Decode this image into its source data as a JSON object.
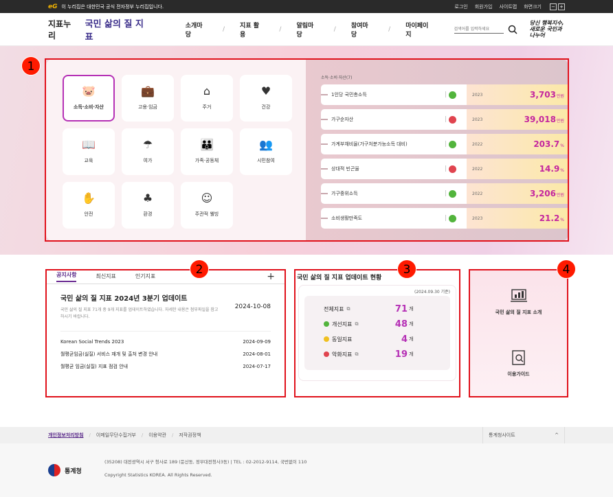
{
  "govbar": {
    "logo": "eG",
    "notice": "이 누리집은 대한민국 공식 전자정부 누리집입니다.",
    "links": [
      "로그인",
      "회원가입",
      "사이트맵",
      "화면크기"
    ]
  },
  "header": {
    "brand_small": "지표누리",
    "brand_main": "국민 삶의 질 지표",
    "nav": [
      "소개마당",
      "지표 활용",
      "알림마당",
      "참여마당",
      "마이페이지"
    ],
    "search_placeholder": "검색어를 입력하세요",
    "slogan": "당신 행복지수, 새로운 국민과 나누어"
  },
  "categories": [
    {
      "label": "소득·소비·자산",
      "icon": "piggy-bank-icon",
      "glyph": "🐷",
      "selected": true
    },
    {
      "label": "고용·임금",
      "icon": "briefcase-icon",
      "glyph": "💼",
      "selected": false
    },
    {
      "label": "주거",
      "icon": "house-icon",
      "glyph": "⌂",
      "selected": false
    },
    {
      "label": "건강",
      "icon": "heart-pulse-icon",
      "glyph": "♥",
      "selected": false
    },
    {
      "label": "교육",
      "icon": "book-icon",
      "glyph": "📖",
      "selected": false
    },
    {
      "label": "여가",
      "icon": "leisure-icon",
      "glyph": "☂",
      "selected": false
    },
    {
      "label": "가족·공동체",
      "icon": "family-icon",
      "glyph": "👪",
      "selected": false
    },
    {
      "label": "시민참여",
      "icon": "people-icon",
      "glyph": "👥",
      "selected": false
    },
    {
      "label": "안전",
      "icon": "hands-icon",
      "glyph": "✋",
      "selected": false
    },
    {
      "label": "환경",
      "icon": "tree-icon",
      "glyph": "♣",
      "selected": false
    },
    {
      "label": "주관적 웰빙",
      "icon": "smile-icon",
      "glyph": "☺",
      "selected": false
    }
  ],
  "stats": {
    "caption": "소득·소비·자산(7)",
    "rows": [
      {
        "name": "1인당 국민총소득",
        "status": "good",
        "year": "2023",
        "value": "3,703",
        "unit": "만원"
      },
      {
        "name": "가구순자산",
        "status": "bad",
        "year": "2023",
        "value": "39,018",
        "unit": "만원"
      },
      {
        "name": "가계부채비율(가구처분가능소득 대비)",
        "status": "good",
        "year": "2022",
        "value": "203.7",
        "unit": "%"
      },
      {
        "name": "상대적 빈곤율",
        "status": "bad",
        "year": "2022",
        "value": "14.9",
        "unit": "%"
      },
      {
        "name": "가구중위소득",
        "status": "good",
        "year": "2022",
        "value": "3,206",
        "unit": "만원"
      },
      {
        "name": "소비생활만족도",
        "status": "good",
        "year": "2023",
        "value": "21.2",
        "unit": "%"
      }
    ]
  },
  "badges": [
    "1",
    "2",
    "3",
    "4"
  ],
  "notices": {
    "tabs": [
      "공지사항",
      "최신지표",
      "인기지표"
    ],
    "plus": "+",
    "main": {
      "title": "국민 삶의 질 지표 2024년 3분기 업데이트",
      "desc": "국민 삶의 질 지표 71개 중 9개 지표를 업데이트하였습니다. 자세한 내용은 첨부파일을 참고하시기 바랍니다.",
      "date": "2024-10-08"
    },
    "items": [
      {
        "title": "Korean Social Trends 2023",
        "date": "2024-09-09"
      },
      {
        "title": "월평균임금(실질) 서비스 재개 및 출처 변경 안내",
        "date": "2024-08-01"
      },
      {
        "title": "월평균 임금(실질) 지표 점검 안내",
        "date": "2024-07-17"
      }
    ]
  },
  "update": {
    "title": "국민 삶의 질 지표 업데이트 현황",
    "date": "(2024.09.30 기준)",
    "rows": [
      {
        "label": "전체지표",
        "count": "71",
        "unit": "개",
        "dot": ""
      },
      {
        "label": "개선지표",
        "count": "48",
        "unit": "개",
        "dot": "#52b43c"
      },
      {
        "label": "동일지표",
        "count": "4",
        "unit": "개",
        "dot": "#f0c020"
      },
      {
        "label": "악화지표",
        "count": "19",
        "unit": "개",
        "dot": "#e0444f"
      }
    ],
    "link_glyph": "⧉"
  },
  "side": {
    "intro": "국민 삶의 질 지표 소개",
    "guide": "이용가이드"
  },
  "footbar": {
    "links": [
      "개인정보처리방침",
      "이메일무단수집거부",
      "이용약관",
      "저작권정책"
    ],
    "family_site": "통계청사이트",
    "caret": "^"
  },
  "footer": {
    "org": "통계청",
    "address": "(35208) 대전광역시 서구 청사로 189 (둔산동, 정부대전청사3동)  |  TEL : 02-2012-9114, 국번없이 110",
    "copyright": "Copyright Statistics KOREA. All Rights Reserved."
  }
}
